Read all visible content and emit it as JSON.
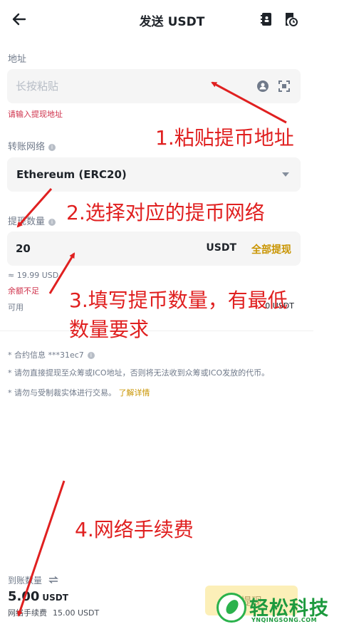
{
  "header": {
    "title": "发送 USDT"
  },
  "address": {
    "label": "地址",
    "placeholder": "长按粘贴",
    "error": "请输入提现地址"
  },
  "network": {
    "label": "转账网络",
    "value": "Ethereum (ERC20)"
  },
  "amount": {
    "label": "提现数量",
    "value": "20",
    "unit": "USDT",
    "all_label": "全部提现",
    "approx": "≈ 19.99 USD",
    "error": "余额不足",
    "available_label": "可用",
    "available_value": "0 USDT"
  },
  "notes": {
    "contract": "* 合约信息 ***31ec7",
    "warning": "* 请勿直接提现至众筹或ICO地址，否则将无法收到众筹或ICO发放的代币。",
    "sanction": "* 请勿与受制裁实体进行交易。",
    "learn_more": "了解详情"
  },
  "annotations": {
    "step1": "1.粘贴提币地址",
    "step2": "2.选择对应的提币网络",
    "step3_line1": "3.填写提币数量，有最低",
    "step3_line2": "数量要求",
    "step4": "4.网络手续费"
  },
  "summary": {
    "receive_label": "到账数量",
    "receive_amount": "5.00",
    "receive_unit": "USDT",
    "fee_label": "网络手续费",
    "fee_value": "15.00 USDT",
    "submit_label": "提现"
  },
  "watermark": {
    "text": "轻松科技",
    "sub": "YNQINGSONG.COM"
  },
  "colors": {
    "accent": "#c99400",
    "error": "#cf304a",
    "annotation": "#e02020",
    "watermark": "#1d9a3e"
  }
}
